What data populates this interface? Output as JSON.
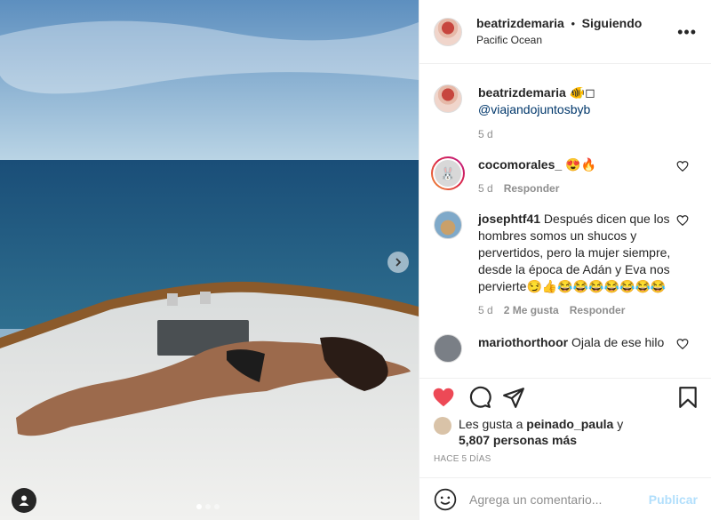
{
  "post": {
    "username": "beatrizdemaria",
    "follow_state": "Siguiendo",
    "separator": "•",
    "location": "Pacific Ocean",
    "more_icon": "more-options-icon",
    "carousel": {
      "count": 3,
      "active": 1
    }
  },
  "caption": {
    "username": "beatrizdemaria",
    "emoji": "🐠◻",
    "mention": "@viajandojuntosbyb",
    "time": "5 d"
  },
  "comments": [
    {
      "username": "cocomorales_",
      "text": "😍🔥",
      "time": "5 d",
      "reply_label": "Responder",
      "avatar_glyph": "🐰"
    },
    {
      "username": "josephtf41",
      "text": "Después dicen que los hombres somos un shucos y pervertidos, pero la mujer siempre, desde la época de Adán y Eva nos pervierte😏👍😂😂😂😂😂😂😂",
      "time": "5 d",
      "likes_label": "2 Me gusta",
      "reply_label": "Responder"
    },
    {
      "username": "mariothorthoor",
      "text": "Ojala de ese hilo"
    }
  ],
  "likes": {
    "prefix": "Les gusta a",
    "liker": "peinado_paula",
    "conj": "y",
    "others": "5,807 personas más"
  },
  "timestamp": "HACE 5 DÍAS",
  "composer": {
    "placeholder": "Agrega un comentario...",
    "publish_label": "Publicar"
  },
  "colors": {
    "like_red": "#ed4956",
    "link_blue": "#00376b",
    "publish_blue": "#b2dffc",
    "muted": "#8e8e8e"
  }
}
